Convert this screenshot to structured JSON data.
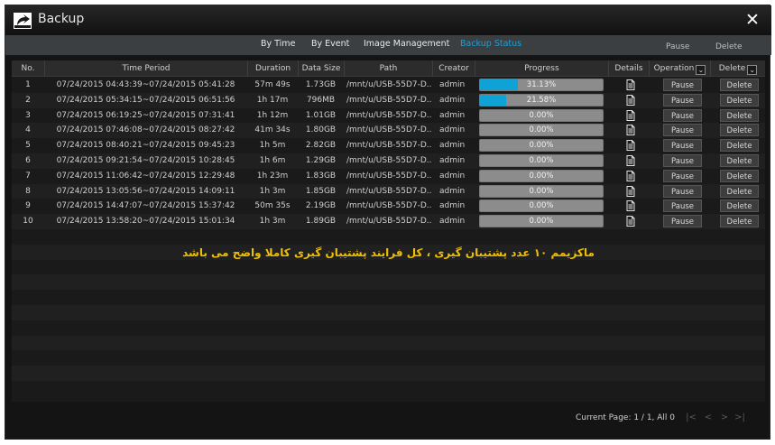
{
  "window": {
    "title": "Backup",
    "close_icon": "close-icon"
  },
  "tabs": [
    {
      "label": "By Time",
      "active": false
    },
    {
      "label": "By Event",
      "active": false
    },
    {
      "label": "Image Management",
      "active": false
    },
    {
      "label": "Backup Status",
      "active": true
    }
  ],
  "top_actions": {
    "pause": "Pause",
    "delete": "Delete"
  },
  "table": {
    "headers": {
      "no": "No.",
      "time_period": "Time Period",
      "duration": "Duration",
      "data_size": "Data Size",
      "path": "Path",
      "creator": "Creator",
      "progress": "Progress",
      "details": "Details",
      "operation": "Operation",
      "delete": "Delete"
    },
    "rows": [
      {
        "no": "1",
        "time": "07/24/2015 04:43:39~07/24/2015 05:41:28",
        "duration": "57m 49s",
        "size": "1.73GB",
        "path": "/mnt/u/USB-55D7-D...",
        "creator": "admin",
        "progress_text": "31.13%",
        "progress": 31.13,
        "pause": "Pause",
        "delete": "Delete"
      },
      {
        "no": "2",
        "time": "07/24/2015 05:34:15~07/24/2015 06:51:56",
        "duration": "1h 17m",
        "size": "796MB",
        "path": "/mnt/u/USB-55D7-D...",
        "creator": "admin",
        "progress_text": "21.58%",
        "progress": 21.58,
        "pause": "Pause",
        "delete": "Delete"
      },
      {
        "no": "3",
        "time": "07/24/2015 06:19:25~07/24/2015 07:31:41",
        "duration": "1h 12m",
        "size": "1.01GB",
        "path": "/mnt/u/USB-55D7-D...",
        "creator": "admin",
        "progress_text": "0.00%",
        "progress": 0,
        "pause": "Pause",
        "delete": "Delete"
      },
      {
        "no": "4",
        "time": "07/24/2015 07:46:08~07/24/2015 08:27:42",
        "duration": "41m 34s",
        "size": "1.80GB",
        "path": "/mnt/u/USB-55D7-D...",
        "creator": "admin",
        "progress_text": "0.00%",
        "progress": 0,
        "pause": "Pause",
        "delete": "Delete"
      },
      {
        "no": "5",
        "time": "07/24/2015 08:40:21~07/24/2015 09:45:23",
        "duration": "1h 5m",
        "size": "2.82GB",
        "path": "/mnt/u/USB-55D7-D...",
        "creator": "admin",
        "progress_text": "0.00%",
        "progress": 0,
        "pause": "Pause",
        "delete": "Delete"
      },
      {
        "no": "6",
        "time": "07/24/2015 09:21:54~07/24/2015 10:28:45",
        "duration": "1h 6m",
        "size": "1.29GB",
        "path": "/mnt/u/USB-55D7-D...",
        "creator": "admin",
        "progress_text": "0.00%",
        "progress": 0,
        "pause": "Pause",
        "delete": "Delete"
      },
      {
        "no": "7",
        "time": "07/24/2015 11:06:42~07/24/2015 12:29:48",
        "duration": "1h 23m",
        "size": "1.83GB",
        "path": "/mnt/u/USB-55D7-D...",
        "creator": "admin",
        "progress_text": "0.00%",
        "progress": 0,
        "pause": "Pause",
        "delete": "Delete"
      },
      {
        "no": "8",
        "time": "07/24/2015 13:05:56~07/24/2015 14:09:11",
        "duration": "1h 3m",
        "size": "1.85GB",
        "path": "/mnt/u/USB-55D7-D...",
        "creator": "admin",
        "progress_text": "0.00%",
        "progress": 0,
        "pause": "Pause",
        "delete": "Delete"
      },
      {
        "no": "9",
        "time": "07/24/2015 14:47:07~07/24/2015 15:37:42",
        "duration": "50m 35s",
        "size": "2.19GB",
        "path": "/mnt/u/USB-55D7-D...",
        "creator": "admin",
        "progress_text": "0.00%",
        "progress": 0,
        "pause": "Pause",
        "delete": "Delete"
      },
      {
        "no": "10",
        "time": "07/24/2015 13:58:20~07/24/2015 15:01:34",
        "duration": "1h 3m",
        "size": "1.89GB",
        "path": "/mnt/u/USB-55D7-D...",
        "creator": "admin",
        "progress_text": "0.00%",
        "progress": 0,
        "pause": "Pause",
        "delete": "Delete"
      }
    ]
  },
  "note": "ماکزیمم ۱۰ عدد پشتیبان گیری ، کل فرایند پشتیبان گیری کاملا واضح می باشد",
  "pager": {
    "text": "Current Page: 1 / 1, All 0",
    "buttons": [
      "|<",
      "<",
      ">",
      ">|"
    ]
  },
  "colors": {
    "accent": "#1e9fd8",
    "progress_fill": "#0ea2d6",
    "note": "#f0c000"
  }
}
